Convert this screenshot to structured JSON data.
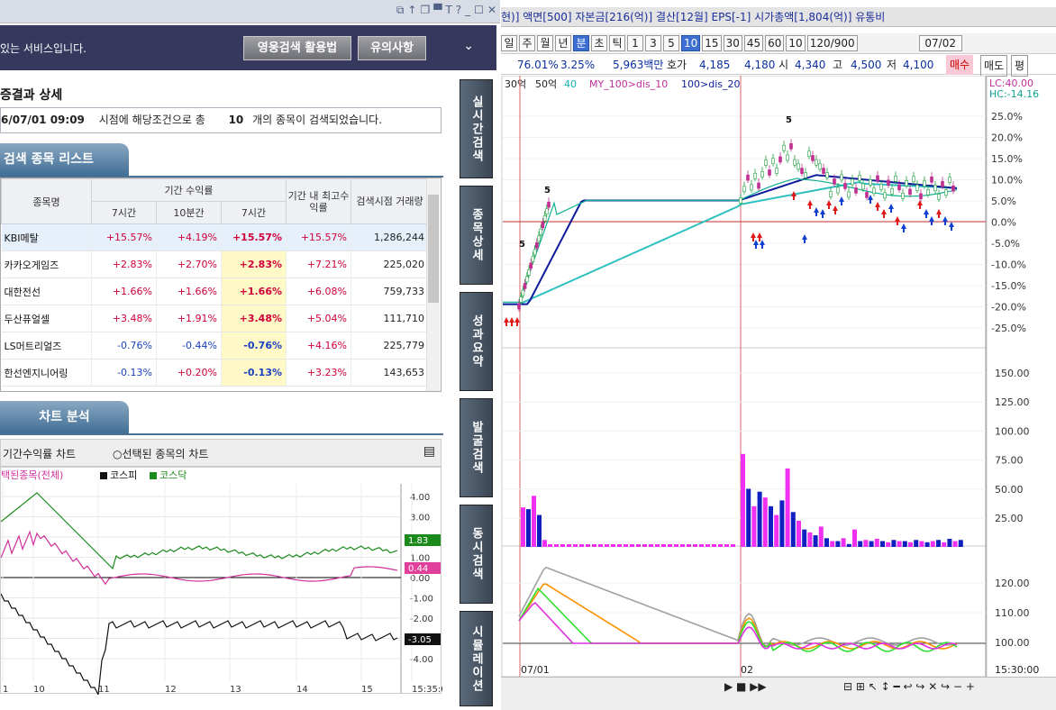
{
  "left": {
    "service_msg": "있는 서비스입니다.",
    "btn_howto": "영웅검색 활용법",
    "btn_notes": "유의사항",
    "result_title": "증결과 상세",
    "info_time": "6/07/01 09:09",
    "info_pre": "시점에 해당조건으로 총",
    "info_count": "10",
    "info_post": "개의 종목이 검색되었습니다.",
    "list_tab": "검색 종목 리스트",
    "headers": {
      "name": "종목명",
      "period_return": "기간 수익률",
      "h7": "7시간",
      "h10": "10분간",
      "h7b": "7시간",
      "max": "기간 내 최고수익률",
      "volume": "검색시점 거래량"
    },
    "rows": [
      {
        "name": "KBI메탈",
        "a": "+15.57%",
        "b": "+4.19%",
        "c": "+15.57%",
        "d": "+15.57%",
        "v": "1,286,244"
      },
      {
        "name": "카카오게임즈",
        "a": "+2.83%",
        "b": "+2.70%",
        "c": "+2.83%",
        "d": "+7.21%",
        "v": "225,020"
      },
      {
        "name": "대한전선",
        "a": "+1.66%",
        "b": "+1.66%",
        "c": "+1.66%",
        "d": "+6.08%",
        "v": "759,733"
      },
      {
        "name": "두산퓨얼셀",
        "a": "+3.48%",
        "b": "+1.91%",
        "c": "+3.48%",
        "d": "+5.04%",
        "v": "111,710"
      },
      {
        "name": "LS머트리얼즈",
        "a": "-0.76%",
        "b": "-0.44%",
        "c": "-0.76%",
        "d": "+4.16%",
        "v": "225,779"
      },
      {
        "name": "한선엔지니어링",
        "a": "-0.13%",
        "b": "+0.20%",
        "c": "-0.13%",
        "d": "+3.23%",
        "v": "143,653"
      }
    ],
    "chart_tab": "차트 분석",
    "radio1": "기간수익률 차트",
    "radio2": "선택된 종목의 차트",
    "legend": [
      "택된종목(전체)",
      "코스피",
      "코스닥"
    ],
    "yticks": [
      "4.00",
      "3.00",
      "2.00",
      "1.00",
      "0.00",
      "-1.00",
      "-2.00",
      "-3.00",
      "-4.00"
    ],
    "xticks": [
      "1",
      "10",
      "11",
      "12",
      "13",
      "14",
      "15",
      "15:35:00"
    ],
    "badge_green": "1.83",
    "badge_pink": "0.44",
    "badge_black": "-3.05",
    "vtabs": [
      "실시간검색",
      "종목상세",
      "성과요약",
      "발굴검색",
      "동시검색",
      "시뮬레이션"
    ]
  },
  "right": {
    "title": "현)] 액면[500] 자본금[216(억)] 결산[12월] EPS[-1] 시가총액[1,804(억)] 유통비",
    "tool": [
      "일",
      "주",
      "월",
      "년",
      "분",
      "초",
      "틱",
      "1",
      "3",
      "5",
      "10",
      "15",
      "30",
      "45",
      "60",
      "10",
      "120/900",
      "07/02"
    ],
    "quote": [
      "76.01%",
      "3.25%",
      "5,963백만",
      "호가",
      "4,185",
      "4,180",
      "시",
      "4,340",
      "고",
      "4,500",
      "저",
      "4,100",
      "매수",
      "매도",
      "평"
    ],
    "legend": [
      "30억",
      "50억",
      "40",
      "MY_100>dis_10",
      "100>dis_20"
    ],
    "lc": "LC:40.00",
    "hc": "HC:-14.16",
    "price_ticks": [
      "25.0%",
      "20.0%",
      "15.0%",
      "10.0%",
      "5.0%",
      "0.0%",
      "-5.0%",
      "-10.0%",
      "-15.0%",
      "-20.0%",
      "-25.0%"
    ],
    "vol_ticks": [
      "150.00",
      "125.00",
      "100.00",
      "75.00",
      "50.00",
      "25.00"
    ],
    "ind_ticks": [
      "120.00",
      "110.00",
      "100.00"
    ],
    "dates": [
      "07/01",
      "02",
      "15:30:00"
    ],
    "mark5": "5"
  }
}
